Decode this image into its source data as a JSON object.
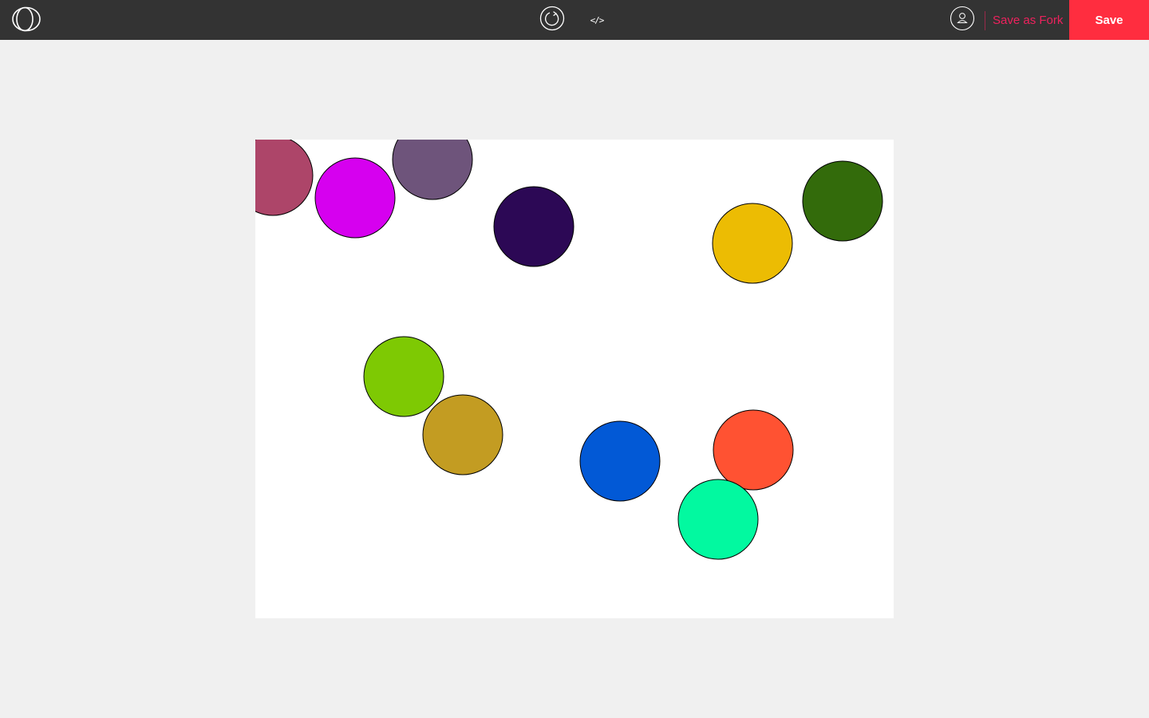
{
  "colors": {
    "toolbar_bg": "#333333",
    "page_bg": "#f0f0f0",
    "accent": "#ed225d",
    "save_bg": "#ff2d3f",
    "fork_text": "#ed225d",
    "icon_stroke": "#ffffff",
    "canvas_bg": "#ffffff",
    "circle_stroke": "#000000"
  },
  "toolbar": {
    "logo_icon": "p5-logo-icon",
    "refresh_icon": "refresh-icon",
    "code_icon": "code-icon",
    "code_glyph": "</>",
    "user_icon": "user-icon",
    "fork_label": "Save as Fork",
    "save_label": "Save"
  },
  "canvas": {
    "circles": [
      {
        "color": "#ad4569"
      },
      {
        "color": "#d600ef"
      },
      {
        "color": "#6e547b"
      },
      {
        "color": "#2c0855"
      },
      {
        "color": "#ecbc03"
      },
      {
        "color": "#336b0b"
      },
      {
        "color": "#7ec903"
      },
      {
        "color": "#c39c22"
      },
      {
        "color": "#0259d6"
      },
      {
        "color": "#ff5232"
      },
      {
        "color": "#02f9a0"
      }
    ]
  }
}
